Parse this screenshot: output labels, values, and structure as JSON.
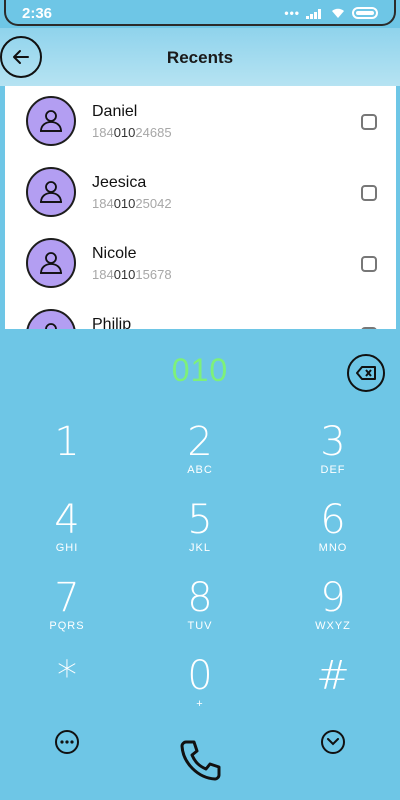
{
  "status_bar": {
    "time": "2:36"
  },
  "header": {
    "title": "Recents"
  },
  "contacts": [
    {
      "name": "Daniel",
      "number_prefix": "184",
      "number_match": "010",
      "number_suffix": "24685"
    },
    {
      "name": "Jeesica",
      "number_prefix": "184",
      "number_match": "010",
      "number_suffix": "25042"
    },
    {
      "name": "Nicole",
      "number_prefix": "184",
      "number_match": "010",
      "number_suffix": "15678"
    },
    {
      "name": "Philip",
      "number_prefix": "",
      "number_match": "",
      "number_suffix": ""
    }
  ],
  "dialer": {
    "display": "010",
    "keys": [
      {
        "digit": "1",
        "letters": ""
      },
      {
        "digit": "2",
        "letters": "ABC"
      },
      {
        "digit": "3",
        "letters": "DEF"
      },
      {
        "digit": "4",
        "letters": "GHI"
      },
      {
        "digit": "5",
        "letters": "JKL"
      },
      {
        "digit": "6",
        "letters": "MNO"
      },
      {
        "digit": "7",
        "letters": "PQRS"
      },
      {
        "digit": "8",
        "letters": "TUV"
      },
      {
        "digit": "9",
        "letters": "WXYZ"
      },
      {
        "digit": "*",
        "letters": ""
      },
      {
        "digit": "0",
        "letters": "+"
      },
      {
        "digit": "#",
        "letters": ""
      }
    ]
  },
  "icons": {
    "back": "arrow-left-icon",
    "backspace": "backspace-icon",
    "more": "more-icon",
    "call": "phone-icon",
    "collapse": "chevron-down-icon"
  },
  "colors": {
    "background": "#6ec6e6",
    "avatar": "#b39ef2",
    "display_text": "#7ef07a"
  }
}
